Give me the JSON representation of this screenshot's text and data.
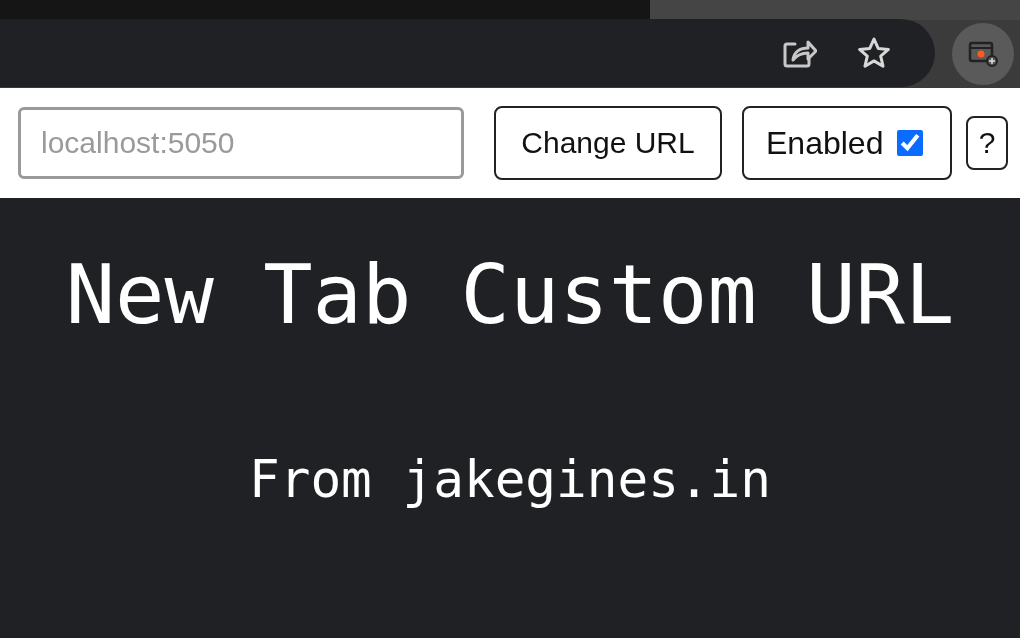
{
  "url_field": {
    "placeholder": "localhost:5050"
  },
  "change_button": {
    "label": "Change URL"
  },
  "enabled_toggle": {
    "label": "Enabled",
    "checked": true
  },
  "help_button": {
    "label": "?"
  },
  "title": "New Tab Custom URL",
  "subtitle": "From jakegines.in"
}
